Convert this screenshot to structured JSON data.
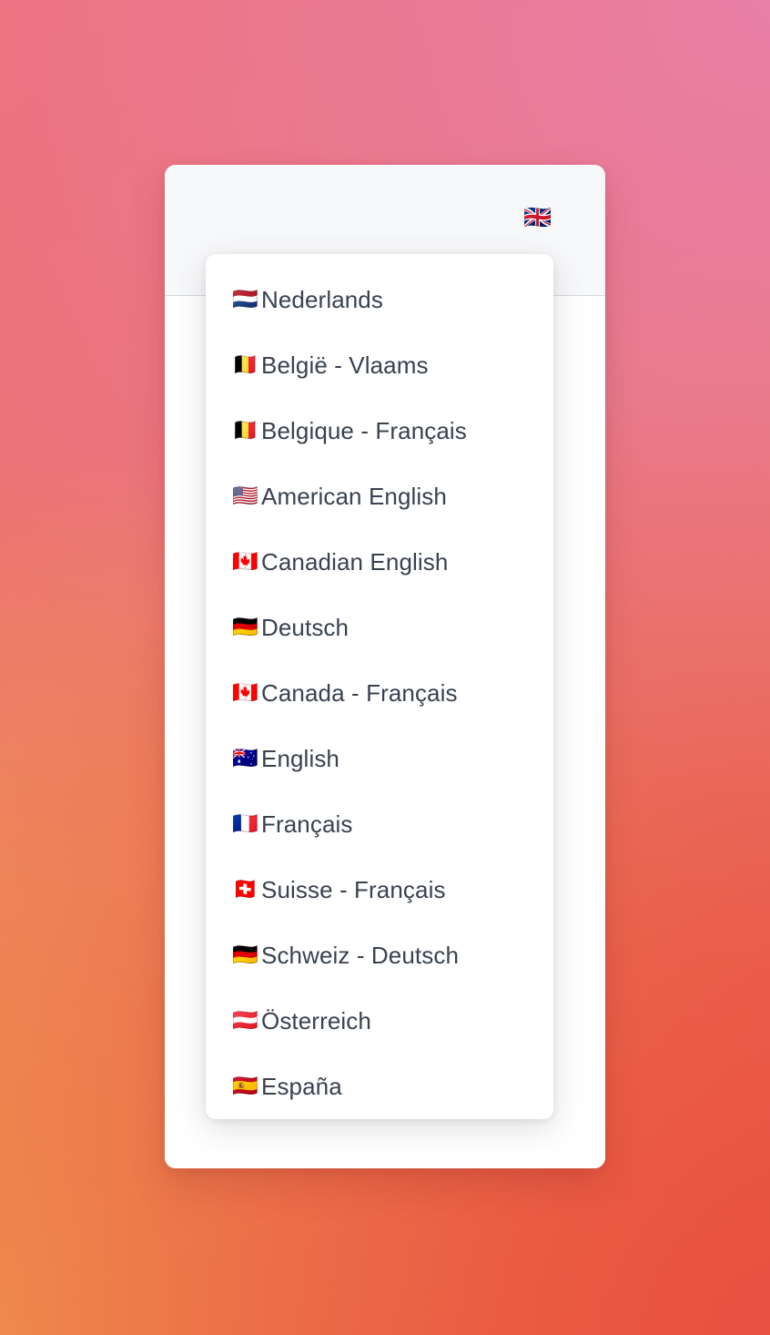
{
  "background": {
    "gradient_from": "#ee7179",
    "gradient_via": "#e87fa5",
    "gradient_to": "#e9503f",
    "gradient_orange": "#ed9350"
  },
  "card": {
    "header_bg": "#f7f8fa",
    "body_bg": "#ffffff",
    "divider_color": "#d6dadd"
  },
  "language_trigger": {
    "name": "language-switcher-button",
    "flag": "🇬🇧",
    "flag_name": "united-kingdom-flag-icon",
    "current_language": "English"
  },
  "language_menu": {
    "open": true,
    "text_color": "#3a424f",
    "items": [
      {
        "flag": "🇳🇱",
        "flag_name": "netherlands-flag-icon",
        "label": "Nederlands"
      },
      {
        "flag": "🇧🇪",
        "flag_name": "belgium-flag-icon",
        "label": "België - Vlaams"
      },
      {
        "flag": "🇧🇪",
        "flag_name": "belgium-flag-icon",
        "label": "Belgique - Français"
      },
      {
        "flag": "🇺🇸",
        "flag_name": "united-states-flag-icon",
        "label": "American English"
      },
      {
        "flag": "🇨🇦",
        "flag_name": "canada-flag-icon",
        "label": "Canadian English"
      },
      {
        "flag": "🇩🇪",
        "flag_name": "germany-flag-icon",
        "label": "Deutsch"
      },
      {
        "flag": "🇨🇦",
        "flag_name": "canada-flag-icon",
        "label": "Canada - Français"
      },
      {
        "flag": "🇦🇺",
        "flag_name": "australia-flag-icon",
        "label": "English"
      },
      {
        "flag": "🇫🇷",
        "flag_name": "france-flag-icon",
        "label": "Français"
      },
      {
        "flag": "🇨🇭",
        "flag_name": "switzerland-flag-icon",
        "label": "Suisse - Français"
      },
      {
        "flag": "🇩🇪",
        "flag_name": "germany-flag-icon",
        "label": "Schweiz - Deutsch"
      },
      {
        "flag": "🇦🇹",
        "flag_name": "austria-flag-icon",
        "label": "Österreich"
      },
      {
        "flag": "🇪🇸",
        "flag_name": "spain-flag-icon",
        "label": "España"
      }
    ]
  }
}
